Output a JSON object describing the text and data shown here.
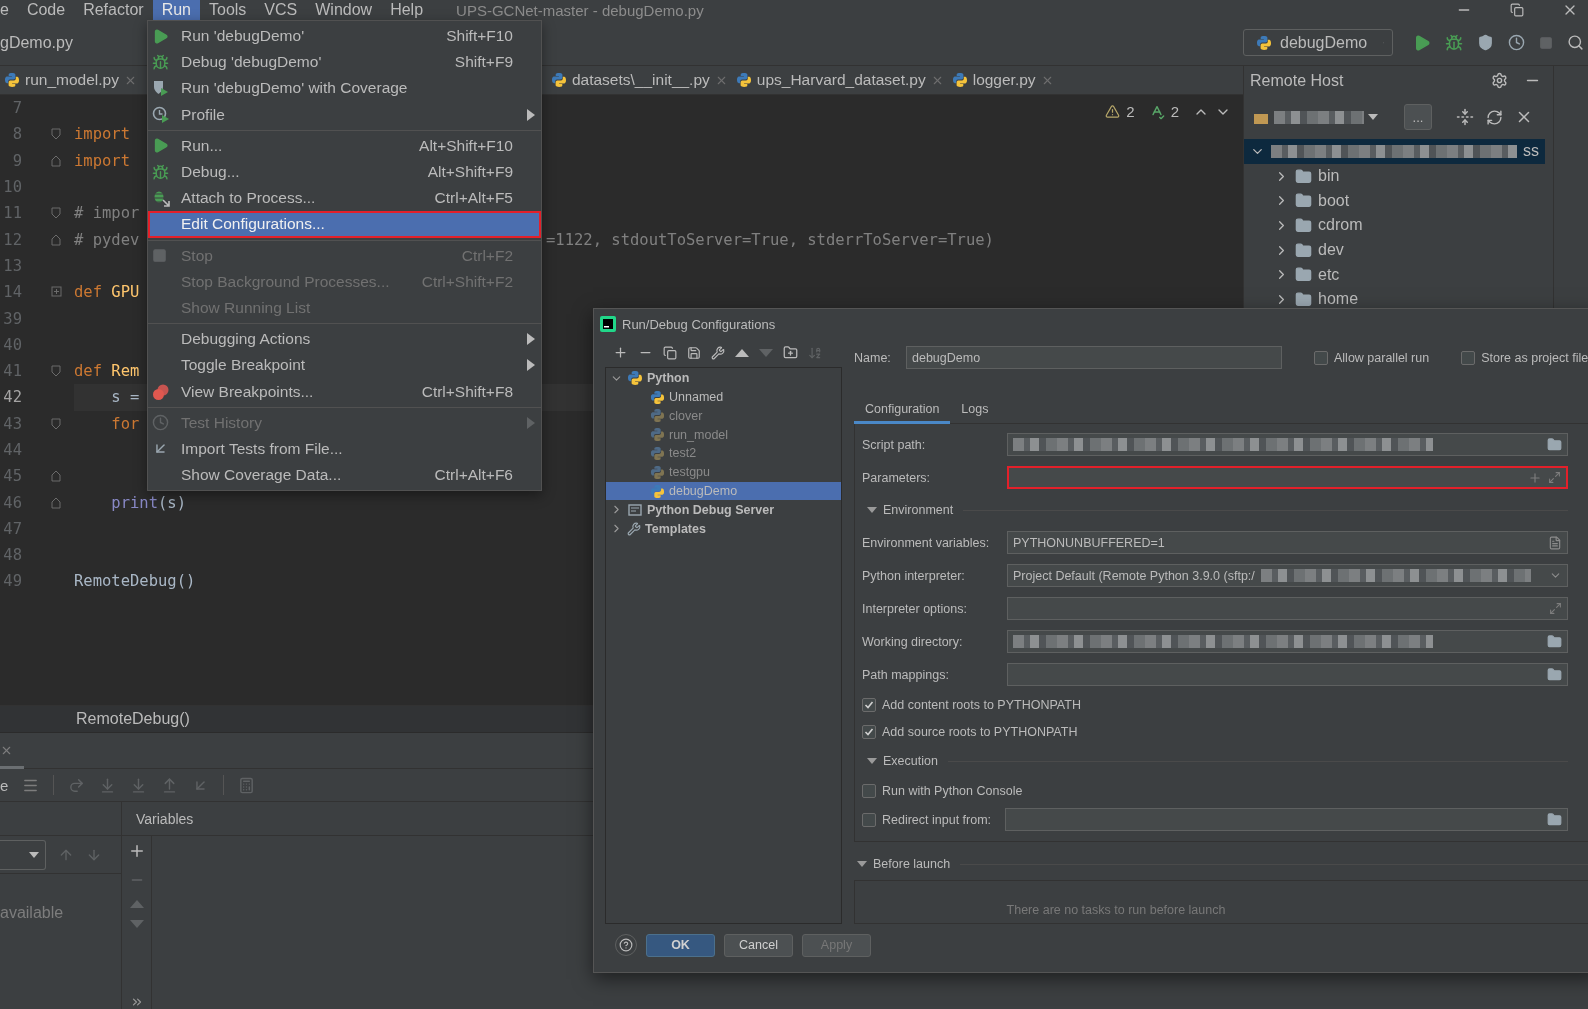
{
  "menu_bar": {
    "title": "UPS-GCNet-master - debugDemo.py",
    "items": [
      {
        "label": "e",
        "selected": false
      },
      {
        "label": "Code",
        "selected": false
      },
      {
        "label": "Refactor",
        "selected": false
      },
      {
        "label": "Run",
        "selected": true
      },
      {
        "label": "Tools",
        "selected": false
      },
      {
        "label": "VCS",
        "selected": false
      },
      {
        "label": "Window",
        "selected": false
      },
      {
        "label": "Help",
        "selected": false
      }
    ]
  },
  "navigation_bar": {
    "breadcrumb": "gDemo.py",
    "run_configuration": "debugDemo"
  },
  "editor_tabs": [
    {
      "label": "run_model.py"
    },
    {
      "label": "datasets\\__init__.py"
    },
    {
      "label": "ups_Harvard_dataset.py"
    },
    {
      "label": "logger.py"
    }
  ],
  "inspections": {
    "warnings": "2",
    "typos": "2"
  },
  "editor": {
    "lines": [
      {
        "number": "7",
        "current": false
      },
      {
        "number": "8",
        "current": false,
        "fold": {
          "kind": "open"
        },
        "code": [
          {
            "kind": "keyword",
            "text": "import"
          }
        ]
      },
      {
        "number": "9",
        "current": false,
        "fold": {
          "kind": "close"
        },
        "code": [
          {
            "kind": "keyword",
            "text": "import"
          }
        ]
      },
      {
        "number": "10",
        "current": false
      },
      {
        "number": "11",
        "current": false,
        "fold": {
          "kind": "open"
        },
        "code": [
          {
            "kind": "comment",
            "text": "# impor"
          }
        ]
      },
      {
        "number": "12",
        "current": false,
        "fold": {
          "kind": "close"
        },
        "code": [
          {
            "kind": "comment",
            "text": "# pydev"
          }
        ],
        "tail": "=1122, stdoutToServer=True, stderrToServer=True)"
      },
      {
        "number": "13",
        "current": false
      },
      {
        "number": "14",
        "current": false,
        "fold": {
          "kind": "collapsed"
        },
        "code": [
          {
            "kind": "keyword",
            "text": "def "
          },
          {
            "kind": "function",
            "text": "GPU"
          }
        ]
      },
      {
        "number": "39",
        "current": false
      },
      {
        "number": "40",
        "current": false
      },
      {
        "number": "41",
        "current": false,
        "fold": {
          "kind": "open"
        },
        "code": [
          {
            "kind": "keyword",
            "text": "def "
          },
          {
            "kind": "function",
            "text": "Rem"
          }
        ]
      },
      {
        "number": "42",
        "current": true,
        "code": [
          {
            "kind": "plain",
            "text": "    s ="
          }
        ]
      },
      {
        "number": "43",
        "current": false,
        "fold": {
          "kind": "open"
        },
        "code": [
          {
            "kind": "keyword",
            "text": "    for"
          }
        ]
      },
      {
        "number": "44",
        "current": false
      },
      {
        "number": "45",
        "current": false,
        "fold": {
          "kind": "close"
        }
      },
      {
        "number": "46",
        "current": false,
        "fold": {
          "kind": "close"
        },
        "code": [
          {
            "kind": "builtin",
            "text": "    print"
          },
          {
            "kind": "plain",
            "text": "(s)"
          }
        ]
      },
      {
        "number": "47",
        "current": false
      },
      {
        "number": "48",
        "current": false
      },
      {
        "number": "49",
        "current": false,
        "code": [
          {
            "kind": "plain",
            "text": "RemoteDebug()"
          }
        ]
      }
    ]
  },
  "breadcrumb": "RemoteDebug()",
  "remote_host": {
    "title": "Remote Host",
    "more_button": "...",
    "tree": [
      {
        "label_tail": "ss",
        "expanded": true,
        "selected": true,
        "children": [
          {
            "label": "bin",
            "expanded": false
          },
          {
            "label": "boot",
            "expanded": false
          },
          {
            "label": "cdrom",
            "expanded": false
          },
          {
            "label": "dev",
            "expanded": false
          },
          {
            "label": "etc",
            "expanded": false
          },
          {
            "label": "home",
            "expanded": false
          }
        ]
      }
    ]
  },
  "debug_panel": {
    "toolbar_text": "e",
    "variables_title": "Variables",
    "frames_message": "available"
  },
  "run_menu": {
    "groups": [
      [
        {
          "label": "Run 'debugDemo'",
          "shortcut": "Shift+F10",
          "disabled": false,
          "selected": false,
          "submenu": false,
          "highlighted": false
        },
        {
          "label": "Debug 'debugDemo'",
          "shortcut": "Shift+F9",
          "disabled": false,
          "selected": false,
          "submenu": false,
          "highlighted": false
        },
        {
          "label": "Run 'debugDemo' with Coverage",
          "disabled": false,
          "selected": false,
          "submenu": false,
          "highlighted": false
        },
        {
          "label": "Profile",
          "disabled": false,
          "selected": false,
          "submenu": true,
          "highlighted": false
        }
      ],
      [
        {
          "label": "Run...",
          "shortcut": "Alt+Shift+F10",
          "disabled": false,
          "selected": false,
          "submenu": false,
          "highlighted": false
        },
        {
          "label": "Debug...",
          "shortcut": "Alt+Shift+F9",
          "disabled": false,
          "selected": false,
          "submenu": false,
          "highlighted": false
        },
        {
          "label": "Attach to Process...",
          "shortcut": "Ctrl+Alt+F5",
          "disabled": false,
          "selected": false,
          "submenu": false,
          "highlighted": false
        },
        {
          "label": "Edit Configurations...",
          "disabled": false,
          "selected": true,
          "submenu": false,
          "highlighted": true
        }
      ],
      [
        {
          "label": "Stop",
          "shortcut": "Ctrl+F2",
          "disabled": true,
          "selected": false,
          "submenu": false,
          "highlighted": false
        },
        {
          "label": "Stop Background Processes...",
          "shortcut": "Ctrl+Shift+F2",
          "disabled": true,
          "selected": false,
          "submenu": false,
          "highlighted": false
        },
        {
          "label": "Show Running List",
          "disabled": true,
          "selected": false,
          "submenu": false,
          "highlighted": false
        }
      ],
      [
        {
          "label": "Debugging Actions",
          "disabled": false,
          "selected": false,
          "submenu": true,
          "highlighted": false
        },
        {
          "label": "Toggle Breakpoint",
          "disabled": false,
          "selected": false,
          "submenu": true,
          "highlighted": false
        },
        {
          "label": "View Breakpoints...",
          "shortcut": "Ctrl+Shift+F8",
          "disabled": false,
          "selected": false,
          "submenu": false,
          "highlighted": false
        }
      ],
      [
        {
          "label": "Test History",
          "disabled": true,
          "selected": false,
          "submenu": true,
          "highlighted": false
        },
        {
          "label": "Import Tests from File...",
          "disabled": false,
          "selected": false,
          "submenu": false,
          "highlighted": false
        },
        {
          "label": "Show Coverage Data...",
          "shortcut": "Ctrl+Alt+F6",
          "disabled": false,
          "selected": false,
          "submenu": false,
          "highlighted": false
        }
      ]
    ]
  },
  "dialog": {
    "title": "Run/Debug Configurations",
    "tree": [
      {
        "label": "Python",
        "expanded": true,
        "selected": false,
        "children": [
          {
            "label": "Unnamed",
            "dimmed": false,
            "selected": false
          },
          {
            "label": "clover",
            "dimmed": true,
            "selected": false
          },
          {
            "label": "run_model",
            "dimmed": true,
            "selected": false
          },
          {
            "label": "test2",
            "dimmed": true,
            "selected": false
          },
          {
            "label": "testgpu",
            "dimmed": true,
            "selected": false
          },
          {
            "label": "debugDemo",
            "dimmed": false,
            "selected": true
          }
        ]
      },
      {
        "label": "Python Debug Server",
        "expanded": false,
        "selected": false
      },
      {
        "label": "Templates",
        "expanded": false,
        "selected": false
      }
    ],
    "name_label": "Name:",
    "name_value": "debugDemo",
    "options": [
      {
        "label": "Allow parallel run",
        "checked": false
      },
      {
        "label": "Store as project file",
        "checked": false
      }
    ],
    "tabs": [
      {
        "label": "Configuration",
        "selected": true
      },
      {
        "label": "Logs",
        "selected": false
      }
    ],
    "configuration": [
      {
        "kind": "field",
        "label": "Script path:",
        "redacted": true,
        "highlighted": false
      },
      {
        "kind": "field",
        "label": "Parameters:",
        "redacted": false,
        "highlighted": true
      },
      {
        "kind": "section",
        "label": "Environment"
      },
      {
        "kind": "field",
        "label": "Environment variables:",
        "value": "PYTHONUNBUFFERED=1",
        "redacted": false,
        "highlighted": false
      },
      {
        "kind": "field",
        "label": "Python interpreter:",
        "value": "Project Default (Remote Python 3.9.0 (sftp:/",
        "redacted": true,
        "highlighted": false
      },
      {
        "kind": "field",
        "label": "Interpreter options:",
        "redacted": false,
        "highlighted": false
      },
      {
        "kind": "field",
        "label": "Working directory:",
        "redacted": true,
        "highlighted": false
      },
      {
        "kind": "field",
        "label": "Path mappings:",
        "redacted": false,
        "highlighted": false
      },
      {
        "kind": "checkbox",
        "label": "Add content roots to PYTHONPATH",
        "checked": true
      },
      {
        "kind": "checkbox",
        "label": "Add source roots to PYTHONPATH",
        "checked": true
      },
      {
        "kind": "section",
        "label": "Execution"
      },
      {
        "kind": "checkbox",
        "label": "Run with Python Console",
        "checked": false
      },
      {
        "kind": "checkbox_field",
        "label": "Redirect input from:",
        "checked": false
      }
    ],
    "before_launch": {
      "label": "Before launch",
      "message": "There are no tasks to run before launch"
    },
    "buttons": [
      {
        "label": "OK",
        "default": true,
        "disabled": false
      },
      {
        "label": "Cancel",
        "default": false,
        "disabled": false
      },
      {
        "label": "Apply",
        "default": false,
        "disabled": true
      }
    ]
  }
}
